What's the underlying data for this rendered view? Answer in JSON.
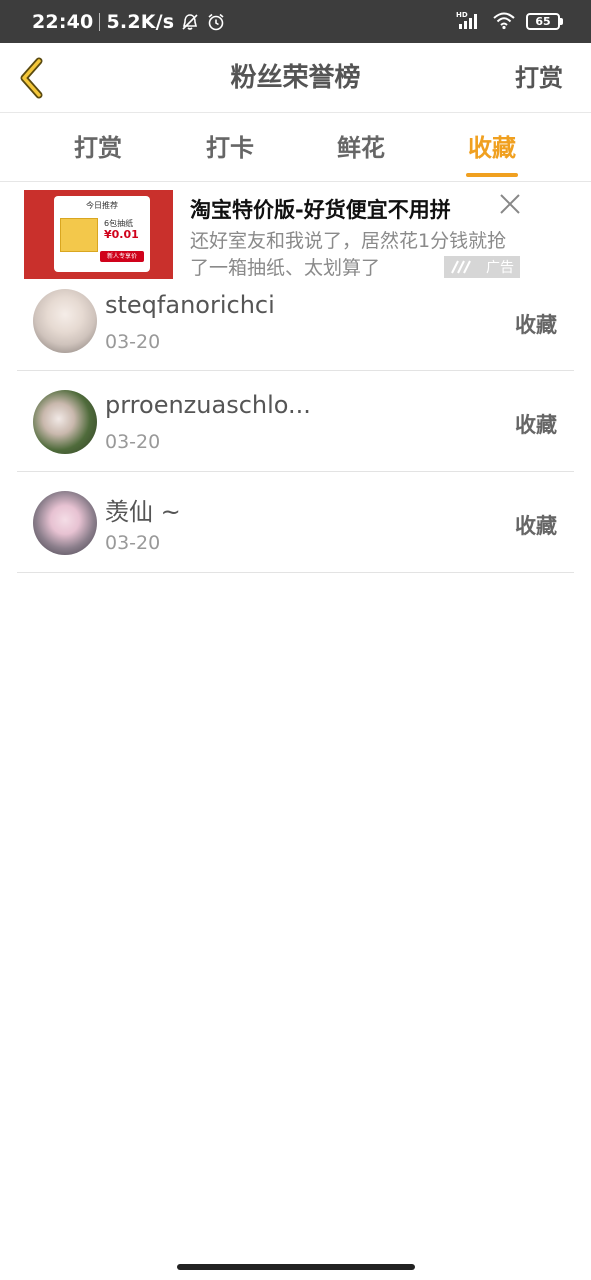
{
  "status_bar": {
    "time": "22:40",
    "net_speed": "5.2K/s",
    "battery": "65",
    "icons": [
      "bell-off-icon",
      "alarm-icon",
      "hd-signal-icon",
      "wifi-icon",
      "battery-icon"
    ]
  },
  "header": {
    "back_icon": "chevron-left-icon",
    "title": "粉丝荣誉榜",
    "action_label": "打赏",
    "accent_color": "#f0a020"
  },
  "tabs": [
    {
      "label": "打赏",
      "active": false
    },
    {
      "label": "打卡",
      "active": false
    },
    {
      "label": "鲜花",
      "active": false
    },
    {
      "label": "收藏",
      "active": true
    }
  ],
  "ad": {
    "title": "淘宝特价版-好货便宜不用拼",
    "description": "还好室友和我说了，居然花1分钱就抢了一箱抽纸、太划算了",
    "tag": "广告",
    "close_icon": "close-icon",
    "thumb": {
      "heading": "今日推荐",
      "product": "6包抽纸",
      "price": "¥0.01",
      "button": "新人专享价"
    }
  },
  "list": [
    {
      "name": "steqfanorichci",
      "date": "03-20",
      "action": "收藏"
    },
    {
      "name": "prroenzuaschlo...",
      "date": "03-20",
      "action": "收藏"
    },
    {
      "name": "羡仙 ~",
      "date": "03-20",
      "action": "收藏"
    }
  ]
}
